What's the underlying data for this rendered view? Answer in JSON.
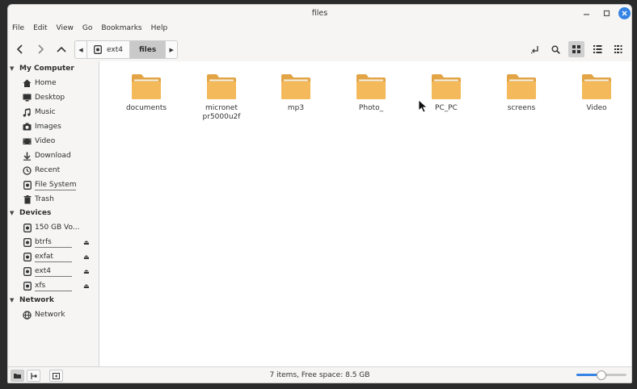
{
  "window": {
    "title": "files"
  },
  "menu": [
    "File",
    "Edit",
    "View",
    "Go",
    "Bookmarks",
    "Help"
  ],
  "breadcrumb": {
    "items": [
      "ext4",
      "files"
    ],
    "active_index": 1
  },
  "sidebar": {
    "sections": [
      {
        "title": "My Computer",
        "items": [
          {
            "label": "Home",
            "icon": "home-icon"
          },
          {
            "label": "Desktop",
            "icon": "desktop-icon"
          },
          {
            "label": "Music",
            "icon": "music-icon"
          },
          {
            "label": "Images",
            "icon": "camera-icon"
          },
          {
            "label": "Video",
            "icon": "video-icon"
          },
          {
            "label": "Download",
            "icon": "download-icon"
          },
          {
            "label": "Recent",
            "icon": "clock-icon"
          },
          {
            "label": "File System",
            "icon": "disk-icon",
            "usage": 0.72
          },
          {
            "label": "Trash",
            "icon": "trash-icon"
          }
        ]
      },
      {
        "title": "Devices",
        "items": [
          {
            "label": "150 GB Vo...",
            "icon": "disk-icon"
          },
          {
            "label": "btrfs",
            "icon": "disk-icon",
            "usage": 0.7,
            "eject": true
          },
          {
            "label": "exfat",
            "icon": "disk-icon",
            "usage": 0.7,
            "eject": true
          },
          {
            "label": "ext4",
            "icon": "disk-icon",
            "usage": 0.7,
            "eject": true
          },
          {
            "label": "xfs",
            "icon": "disk-icon",
            "usage": 0.7,
            "eject": true
          }
        ]
      },
      {
        "title": "Network",
        "items": [
          {
            "label": "Network",
            "icon": "network-icon"
          }
        ]
      }
    ]
  },
  "files": [
    "documents",
    "micronet pr5000u2f",
    "mp3",
    "Photo_",
    "PC_PC",
    "screens",
    "Video"
  ],
  "statusbar": {
    "text": "7 items, Free space: 8.5 GB",
    "zoom_level": 0.5,
    "buttons": [
      "places-icon",
      "tree-icon",
      "hide-sidebar-icon"
    ]
  },
  "colors": {
    "folder": "#f0b654",
    "folder_tab": "#e5a848",
    "accent": "#3584e4"
  }
}
